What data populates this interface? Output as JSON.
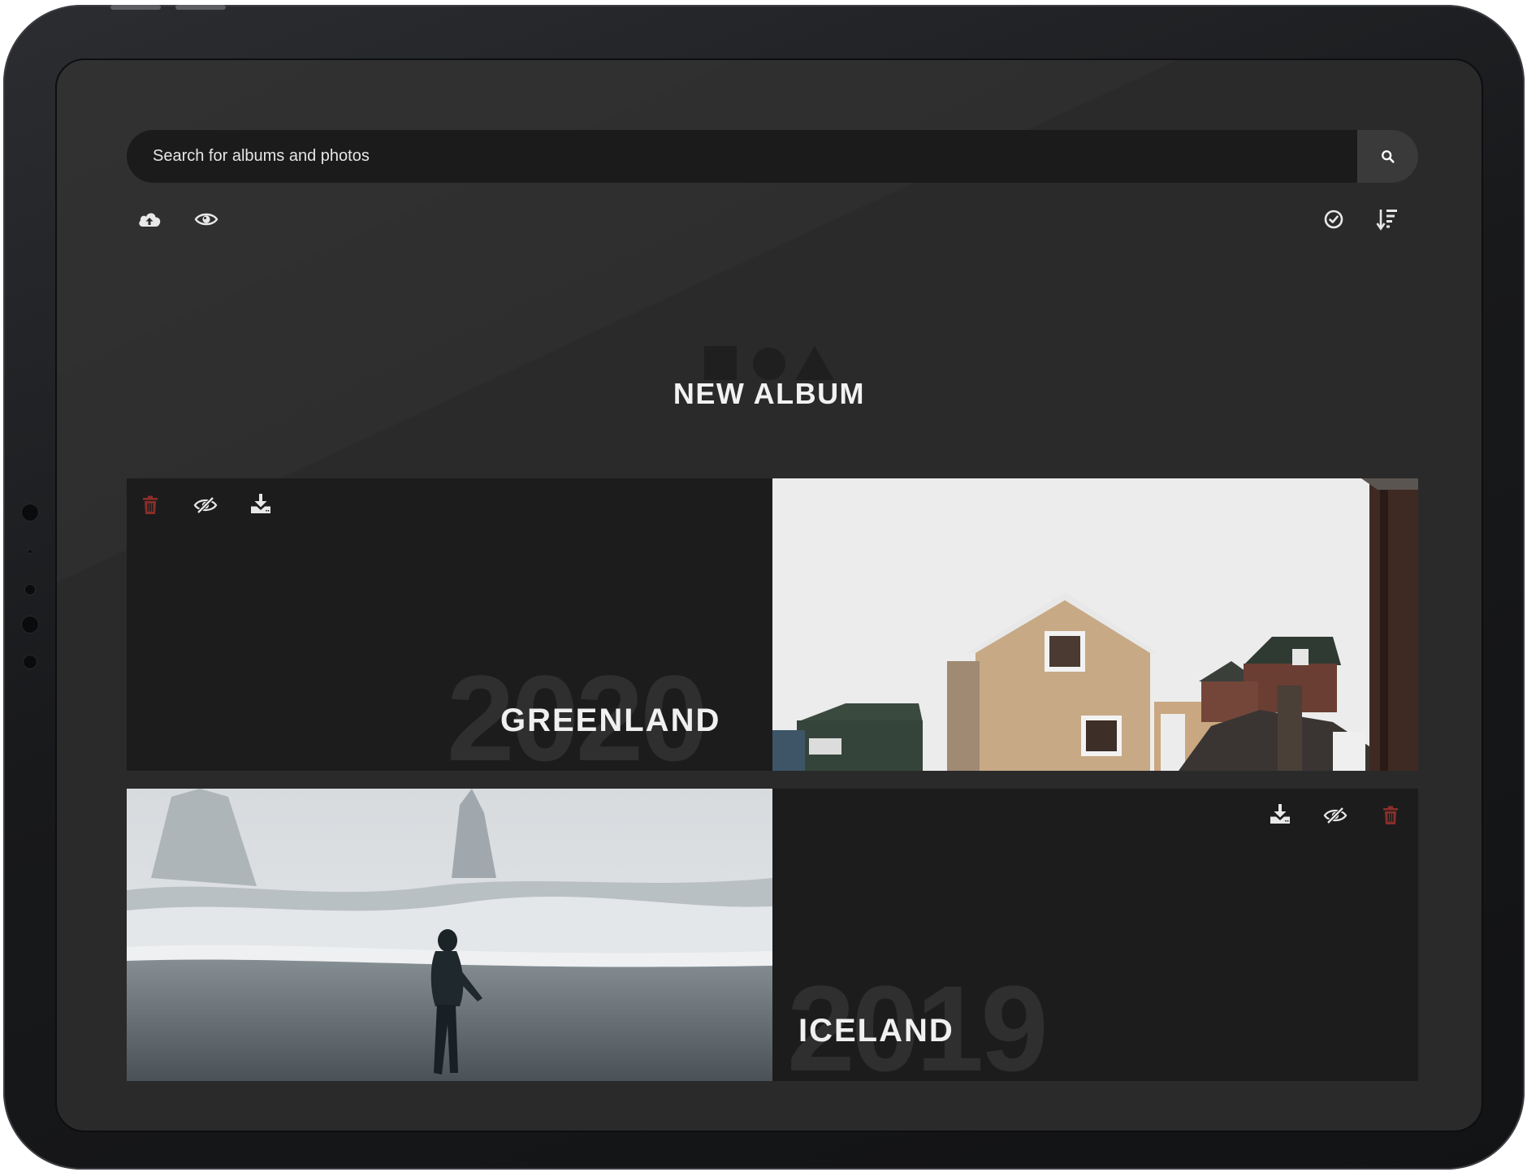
{
  "search": {
    "placeholder": "Search for albums and photos"
  },
  "toolbar": {
    "left": [
      "upload-cloud-icon",
      "eye-icon"
    ],
    "right": [
      "check-circle-icon",
      "sort-icon"
    ]
  },
  "new_album": {
    "label": "NEW ALBUM"
  },
  "albums": [
    {
      "title": "GREENLAND",
      "year": "2020",
      "photo": "houses-landscape",
      "actions": [
        "trash-icon",
        "eye-slash-icon",
        "download-icon"
      ]
    },
    {
      "title": "ICELAND",
      "year": "2019",
      "photo": "person-on-beach",
      "actions": [
        "download-icon",
        "eye-slash-icon",
        "trash-icon"
      ]
    }
  ],
  "colors": {
    "accent_delete": "#8b2e2a",
    "screen_bg": "#2a2a2a",
    "card_bg": "#1c1c1c"
  }
}
